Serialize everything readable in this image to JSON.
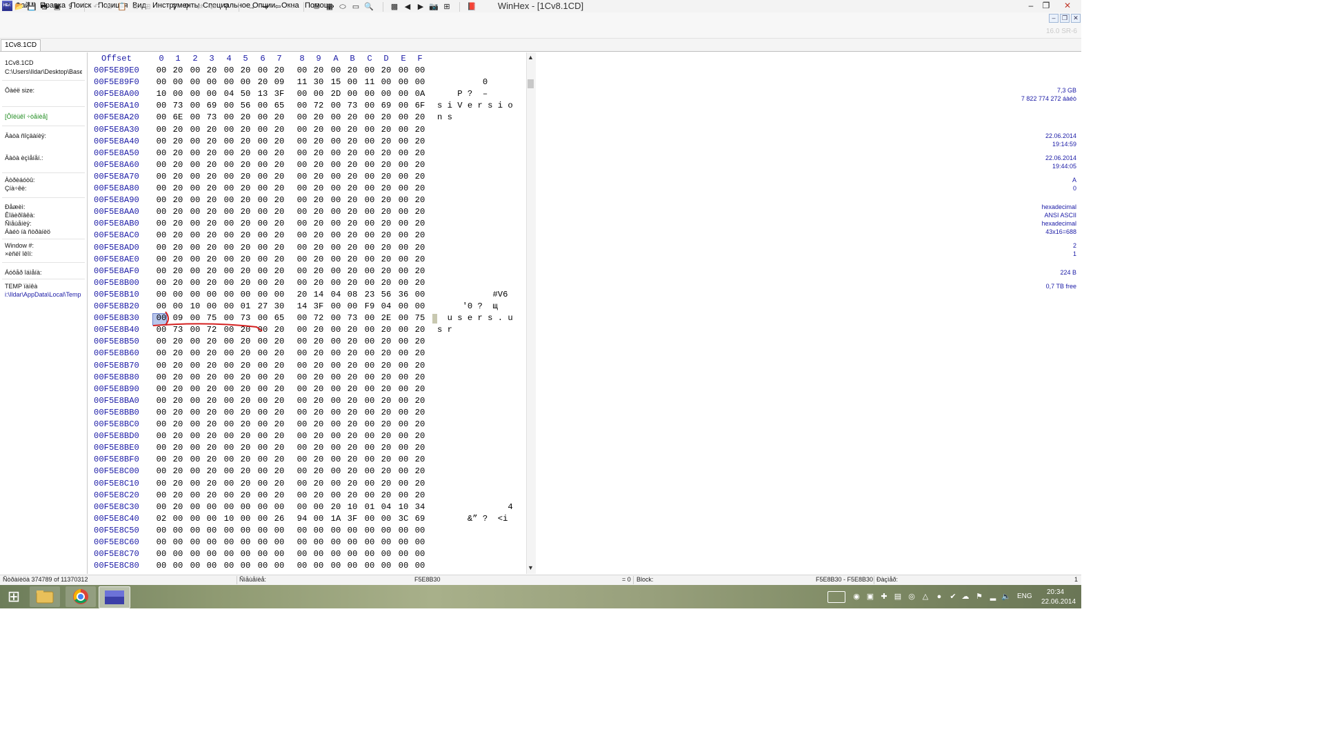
{
  "window": {
    "title": "WinHex - [1Cv8.1CD]",
    "app_icon_label": "HEX",
    "minimize": "–",
    "restore": "❐",
    "close": "✕"
  },
  "menu": {
    "items": [
      "Файл",
      "Правка",
      "Поиск",
      "Позиция",
      "Вид",
      "Инструменты",
      "Специальное",
      "Опции",
      "Окна",
      "Помощь"
    ]
  },
  "toolbar": {
    "version": "16.0 SR-6"
  },
  "tab": {
    "label": "1Cv8.1CD"
  },
  "info": {
    "filename": "1Cv8.1CD",
    "path": "C:\\Users\\Ildar\\Desktop\\Base",
    "file_size_label": "Ôàéë size:",
    "file_size_gb": "7,3 GB",
    "file_size_bytes": "7 822 774 272 áàéò",
    "mode_status": "[Ôîëüêî ÷òåíèå]",
    "created_label": "Äàòà ñîçäàíèÿ:",
    "created_date": "22.06.2014",
    "created_time": "19:14:59",
    "modified_label": "Äàòà èçìåíåí.:",
    "modified_date": "22.06.2014",
    "modified_time": "19:44:05",
    "attr_label": "Àòðèáóòû:",
    "attr_value": "A",
    "icons_label": "Çíà÷êè:",
    "icons_value": "0",
    "mode_label": "Ðåæèì:",
    "mode_value": "hexadecimal",
    "charset_label": "Êîäèðîâêà:",
    "charset_value": "ANSI ASCII",
    "offsets_label": "Ñìåùåíèÿ:",
    "offsets_value": "hexadecimal",
    "bytes_page_label": "Áàéò íà ñòðàíèöó:",
    "bytes_page_value": "43x16=688",
    "window_no_label": "Window #:",
    "window_no_value": "2",
    "window_count_label": "×èñëî îêîí:",
    "window_count_value": "1",
    "clipboard_label": "Áóôåð îáìåíà:",
    "clipboard_value": "224 B",
    "temp_label": "TEMP ïàïêà",
    "temp_value": "0,7 TB free",
    "temp_path": "i:\\Ildar\\AppData\\Local\\Temp"
  },
  "hex": {
    "header_offset": "Offset",
    "header_cols": [
      "0",
      "1",
      "2",
      "3",
      "4",
      "5",
      "6",
      "7",
      "8",
      "9",
      "A",
      "B",
      "C",
      "D",
      "E",
      "F"
    ],
    "rows": [
      {
        "off": "00F5E89E0",
        "b": [
          "00",
          "20",
          "00",
          "20",
          "00",
          "20",
          "00",
          "20",
          "00",
          "20",
          "00",
          "20",
          "00",
          "20",
          "00",
          "00"
        ],
        "a": ""
      },
      {
        "off": "00F5E89F0",
        "b": [
          "00",
          "00",
          "00",
          "00",
          "00",
          "00",
          "20",
          "09",
          "11",
          "30",
          "15",
          "00",
          "11",
          "00",
          "00",
          "00"
        ],
        "a": "         0"
      },
      {
        "off": "00F5E8A00",
        "b": [
          "10",
          "00",
          "00",
          "00",
          "04",
          "50",
          "13",
          "3F",
          "00",
          "00",
          "2D",
          "00",
          "00",
          "00",
          "00",
          "0A"
        ],
        "a": "    P ?  –"
      },
      {
        "off": "00F5E8A10",
        "b": [
          "00",
          "73",
          "00",
          "69",
          "00",
          "56",
          "00",
          "65",
          "00",
          "72",
          "00",
          "73",
          "00",
          "69",
          "00",
          "6F"
        ],
        "a": "s i V e r s i o"
      },
      {
        "off": "00F5E8A20",
        "b": [
          "00",
          "6E",
          "00",
          "73",
          "00",
          "20",
          "00",
          "20",
          "00",
          "20",
          "00",
          "20",
          "00",
          "20",
          "00",
          "20"
        ],
        "a": "n s"
      },
      {
        "off": "00F5E8A30",
        "b": [
          "00",
          "20",
          "00",
          "20",
          "00",
          "20",
          "00",
          "20",
          "00",
          "20",
          "00",
          "20",
          "00",
          "20",
          "00",
          "20"
        ],
        "a": ""
      },
      {
        "off": "00F5E8A40",
        "b": [
          "00",
          "20",
          "00",
          "20",
          "00",
          "20",
          "00",
          "20",
          "00",
          "20",
          "00",
          "20",
          "00",
          "20",
          "00",
          "20"
        ],
        "a": ""
      },
      {
        "off": "00F5E8A50",
        "b": [
          "00",
          "20",
          "00",
          "20",
          "00",
          "20",
          "00",
          "20",
          "00",
          "20",
          "00",
          "20",
          "00",
          "20",
          "00",
          "20"
        ],
        "a": ""
      },
      {
        "off": "00F5E8A60",
        "b": [
          "00",
          "20",
          "00",
          "20",
          "00",
          "20",
          "00",
          "20",
          "00",
          "20",
          "00",
          "20",
          "00",
          "20",
          "00",
          "20"
        ],
        "a": ""
      },
      {
        "off": "00F5E8A70",
        "b": [
          "00",
          "20",
          "00",
          "20",
          "00",
          "20",
          "00",
          "20",
          "00",
          "20",
          "00",
          "20",
          "00",
          "20",
          "00",
          "20"
        ],
        "a": ""
      },
      {
        "off": "00F5E8A80",
        "b": [
          "00",
          "20",
          "00",
          "20",
          "00",
          "20",
          "00",
          "20",
          "00",
          "20",
          "00",
          "20",
          "00",
          "20",
          "00",
          "20"
        ],
        "a": ""
      },
      {
        "off": "00F5E8A90",
        "b": [
          "00",
          "20",
          "00",
          "20",
          "00",
          "20",
          "00",
          "20",
          "00",
          "20",
          "00",
          "20",
          "00",
          "20",
          "00",
          "20"
        ],
        "a": ""
      },
      {
        "off": "00F5E8AA0",
        "b": [
          "00",
          "20",
          "00",
          "20",
          "00",
          "20",
          "00",
          "20",
          "00",
          "20",
          "00",
          "20",
          "00",
          "20",
          "00",
          "20"
        ],
        "a": ""
      },
      {
        "off": "00F5E8AB0",
        "b": [
          "00",
          "20",
          "00",
          "20",
          "00",
          "20",
          "00",
          "20",
          "00",
          "20",
          "00",
          "20",
          "00",
          "20",
          "00",
          "20"
        ],
        "a": ""
      },
      {
        "off": "00F5E8AC0",
        "b": [
          "00",
          "20",
          "00",
          "20",
          "00",
          "20",
          "00",
          "20",
          "00",
          "20",
          "00",
          "20",
          "00",
          "20",
          "00",
          "20"
        ],
        "a": ""
      },
      {
        "off": "00F5E8AD0",
        "b": [
          "00",
          "20",
          "00",
          "20",
          "00",
          "20",
          "00",
          "20",
          "00",
          "20",
          "00",
          "20",
          "00",
          "20",
          "00",
          "20"
        ],
        "a": ""
      },
      {
        "off": "00F5E8AE0",
        "b": [
          "00",
          "20",
          "00",
          "20",
          "00",
          "20",
          "00",
          "20",
          "00",
          "20",
          "00",
          "20",
          "00",
          "20",
          "00",
          "20"
        ],
        "a": ""
      },
      {
        "off": "00F5E8AF0",
        "b": [
          "00",
          "20",
          "00",
          "20",
          "00",
          "20",
          "00",
          "20",
          "00",
          "20",
          "00",
          "20",
          "00",
          "20",
          "00",
          "20"
        ],
        "a": ""
      },
      {
        "off": "00F5E8B00",
        "b": [
          "00",
          "20",
          "00",
          "20",
          "00",
          "20",
          "00",
          "20",
          "00",
          "20",
          "00",
          "20",
          "00",
          "20",
          "00",
          "20"
        ],
        "a": ""
      },
      {
        "off": "00F5E8B10",
        "b": [
          "00",
          "00",
          "00",
          "00",
          "00",
          "00",
          "00",
          "00",
          "20",
          "14",
          "04",
          "08",
          "23",
          "56",
          "36",
          "00"
        ],
        "a": "           #V6"
      },
      {
        "off": "00F5E8B20",
        "b": [
          "00",
          "00",
          "10",
          "00",
          "00",
          "01",
          "27",
          "30",
          "14",
          "3F",
          "00",
          "00",
          "F9",
          "04",
          "00",
          "00"
        ],
        "a": "     '0 ?  щ"
      },
      {
        "off": "00F5E8B30",
        "b": [
          "00",
          "09",
          "00",
          "75",
          "00",
          "73",
          "00",
          "65",
          "00",
          "72",
          "00",
          "73",
          "00",
          "2E",
          "00",
          "75"
        ],
        "a": "  u s e r s . u"
      },
      {
        "off": "00F5E8B40",
        "b": [
          "00",
          "73",
          "00",
          "72",
          "00",
          "20",
          "00",
          "20",
          "00",
          "20",
          "00",
          "20",
          "00",
          "20",
          "00",
          "20"
        ],
        "a": "s r"
      },
      {
        "off": "00F5E8B50",
        "b": [
          "00",
          "20",
          "00",
          "20",
          "00",
          "20",
          "00",
          "20",
          "00",
          "20",
          "00",
          "20",
          "00",
          "20",
          "00",
          "20"
        ],
        "a": ""
      },
      {
        "off": "00F5E8B60",
        "b": [
          "00",
          "20",
          "00",
          "20",
          "00",
          "20",
          "00",
          "20",
          "00",
          "20",
          "00",
          "20",
          "00",
          "20",
          "00",
          "20"
        ],
        "a": ""
      },
      {
        "off": "00F5E8B70",
        "b": [
          "00",
          "20",
          "00",
          "20",
          "00",
          "20",
          "00",
          "20",
          "00",
          "20",
          "00",
          "20",
          "00",
          "20",
          "00",
          "20"
        ],
        "a": ""
      },
      {
        "off": "00F5E8B80",
        "b": [
          "00",
          "20",
          "00",
          "20",
          "00",
          "20",
          "00",
          "20",
          "00",
          "20",
          "00",
          "20",
          "00",
          "20",
          "00",
          "20"
        ],
        "a": ""
      },
      {
        "off": "00F5E8B90",
        "b": [
          "00",
          "20",
          "00",
          "20",
          "00",
          "20",
          "00",
          "20",
          "00",
          "20",
          "00",
          "20",
          "00",
          "20",
          "00",
          "20"
        ],
        "a": ""
      },
      {
        "off": "00F5E8BA0",
        "b": [
          "00",
          "20",
          "00",
          "20",
          "00",
          "20",
          "00",
          "20",
          "00",
          "20",
          "00",
          "20",
          "00",
          "20",
          "00",
          "20"
        ],
        "a": ""
      },
      {
        "off": "00F5E8BB0",
        "b": [
          "00",
          "20",
          "00",
          "20",
          "00",
          "20",
          "00",
          "20",
          "00",
          "20",
          "00",
          "20",
          "00",
          "20",
          "00",
          "20"
        ],
        "a": ""
      },
      {
        "off": "00F5E8BC0",
        "b": [
          "00",
          "20",
          "00",
          "20",
          "00",
          "20",
          "00",
          "20",
          "00",
          "20",
          "00",
          "20",
          "00",
          "20",
          "00",
          "20"
        ],
        "a": ""
      },
      {
        "off": "00F5E8BD0",
        "b": [
          "00",
          "20",
          "00",
          "20",
          "00",
          "20",
          "00",
          "20",
          "00",
          "20",
          "00",
          "20",
          "00",
          "20",
          "00",
          "20"
        ],
        "a": ""
      },
      {
        "off": "00F5E8BE0",
        "b": [
          "00",
          "20",
          "00",
          "20",
          "00",
          "20",
          "00",
          "20",
          "00",
          "20",
          "00",
          "20",
          "00",
          "20",
          "00",
          "20"
        ],
        "a": ""
      },
      {
        "off": "00F5E8BF0",
        "b": [
          "00",
          "20",
          "00",
          "20",
          "00",
          "20",
          "00",
          "20",
          "00",
          "20",
          "00",
          "20",
          "00",
          "20",
          "00",
          "20"
        ],
        "a": ""
      },
      {
        "off": "00F5E8C00",
        "b": [
          "00",
          "20",
          "00",
          "20",
          "00",
          "20",
          "00",
          "20",
          "00",
          "20",
          "00",
          "20",
          "00",
          "20",
          "00",
          "20"
        ],
        "a": ""
      },
      {
        "off": "00F5E8C10",
        "b": [
          "00",
          "20",
          "00",
          "20",
          "00",
          "20",
          "00",
          "20",
          "00",
          "20",
          "00",
          "20",
          "00",
          "20",
          "00",
          "20"
        ],
        "a": ""
      },
      {
        "off": "00F5E8C20",
        "b": [
          "00",
          "20",
          "00",
          "20",
          "00",
          "20",
          "00",
          "20",
          "00",
          "20",
          "00",
          "20",
          "00",
          "20",
          "00",
          "20"
        ],
        "a": ""
      },
      {
        "off": "00F5E8C30",
        "b": [
          "00",
          "20",
          "00",
          "00",
          "00",
          "00",
          "00",
          "00",
          "00",
          "00",
          "20",
          "10",
          "01",
          "04",
          "10",
          "34"
        ],
        "a": "              4"
      },
      {
        "off": "00F5E8C40",
        "b": [
          "02",
          "00",
          "00",
          "00",
          "10",
          "00",
          "00",
          "26",
          "94",
          "00",
          "1A",
          "3F",
          "00",
          "00",
          "3C",
          "69"
        ],
        "a": "      &” ?  <i"
      },
      {
        "off": "00F5E8C50",
        "b": [
          "00",
          "00",
          "00",
          "00",
          "00",
          "00",
          "00",
          "00",
          "00",
          "00",
          "00",
          "00",
          "00",
          "00",
          "00",
          "00"
        ],
        "a": ""
      },
      {
        "off": "00F5E8C60",
        "b": [
          "00",
          "00",
          "00",
          "00",
          "00",
          "00",
          "00",
          "00",
          "00",
          "00",
          "00",
          "00",
          "00",
          "00",
          "00",
          "00"
        ],
        "a": ""
      },
      {
        "off": "00F5E8C70",
        "b": [
          "00",
          "00",
          "00",
          "00",
          "00",
          "00",
          "00",
          "00",
          "00",
          "00",
          "00",
          "00",
          "00",
          "00",
          "00",
          "00"
        ],
        "a": ""
      },
      {
        "off": "00F5E8C80",
        "b": [
          "00",
          "00",
          "00",
          "00",
          "00",
          "00",
          "00",
          "00",
          "00",
          "00",
          "00",
          "00",
          "00",
          "00",
          "00",
          "00"
        ],
        "a": ""
      }
    ],
    "annotation_color": "#d42020",
    "cursor_color": "#b8c6ec"
  },
  "statusbar": {
    "page": "Ñòðàíèöà 374789 of 11370312",
    "offset_label": "Ñìåùåíèå:",
    "offset_value": "F5E8B30",
    "value": "= 0",
    "block_label": "Block:",
    "block_value": "F5E8B30 - F5E8B30",
    "size_label": "Ðàçìåð:",
    "size_value": "1"
  },
  "taskbar": {
    "start_icon": "windows-logo",
    "lang": "ENG",
    "time": "20:34",
    "date": "22.06.2014"
  }
}
